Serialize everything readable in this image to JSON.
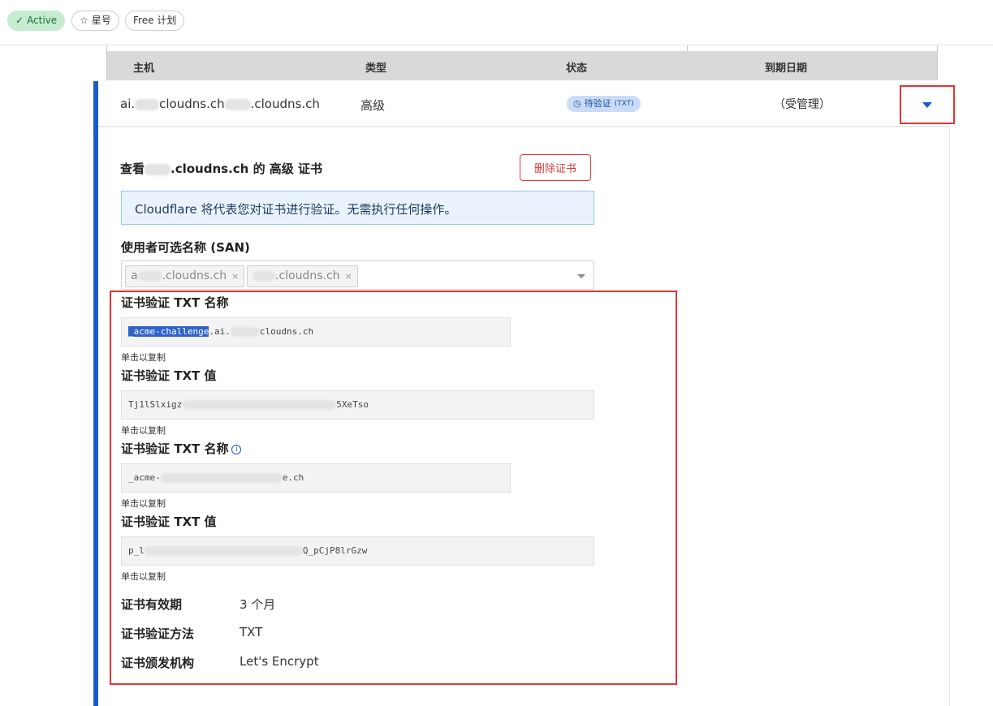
{
  "badges": {
    "active": "Active",
    "star": "星号",
    "plan": "Free 计划"
  },
  "table": {
    "columns": [
      "主机",
      "类型",
      "状态",
      "到期日期"
    ]
  },
  "row": {
    "host_part1": "ai.",
    "host_part2": "cloudns.ch",
    "host_part3": ".cloudns.ch",
    "type": "高级",
    "status": "待验证",
    "status_sub": "(TXT)",
    "expiry": "（受管理）"
  },
  "panel": {
    "title_prefix": "查看",
    "title_suffix": ".cloudns.ch 的 高级 证书",
    "delete_button": "删除证书",
    "info_text": "Cloudflare 将代表您对证书进行验证。无需执行任何操作。",
    "san_label": "使用者可选名称 (SAN)",
    "san_chips": [
      {
        "prefix": "a",
        "suffix": ".cloudns.ch"
      },
      {
        "prefix": "",
        "suffix": ".cloudns.ch"
      }
    ],
    "records": [
      {
        "label": "证书验证 TXT 名称",
        "selected": "_acme-challenge",
        "value": ".ai.",
        "value_end": "cloudns.ch",
        "hint": "单击以复制",
        "info": false
      },
      {
        "label": "证书验证 TXT 值",
        "selected": "",
        "value": "Tj1lSlxigz",
        "value_end": "5XeTso",
        "hint": "单击以复制",
        "info": false
      },
      {
        "label": "证书验证 TXT 名称",
        "selected": "",
        "value": "_acme-",
        "value_end": "e.ch",
        "hint": "单击以复制",
        "info": true
      },
      {
        "label": "证书验证 TXT 值",
        "selected": "",
        "value": "p_l",
        "value_end": "Q_pCjP8lrGzw",
        "hint": "单击以复制",
        "info": false
      }
    ],
    "details": [
      {
        "key": "证书有效期",
        "value": "3 个月"
      },
      {
        "key": "证书验证方法",
        "value": "TXT"
      },
      {
        "key": "证书颁发机构",
        "value": "Let's Encrypt"
      }
    ]
  },
  "colors": {
    "accent": "#1a5ac8",
    "highlight_border": "#e03535",
    "active_badge": "#c5ecd0",
    "status_badge": "#c9dcf7"
  }
}
